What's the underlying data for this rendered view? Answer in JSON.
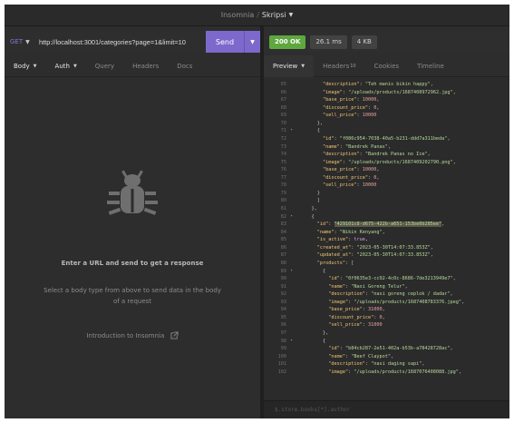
{
  "titlebar": {
    "app": "Insomnia",
    "separator": "/",
    "workspace": "Skripsi"
  },
  "request": {
    "method": "GET",
    "url": "http://localhost:3001/categories?page=1&limit=10",
    "send_label": "Send"
  },
  "response": {
    "status": "200 OK",
    "time": "26.1 ms",
    "size": "4 KB"
  },
  "request_tabs": [
    {
      "label": "Body",
      "dropdown": true,
      "active": true
    },
    {
      "label": "Auth",
      "dropdown": true,
      "active": false
    },
    {
      "label": "Query"
    },
    {
      "label": "Headers"
    },
    {
      "label": "Docs"
    }
  ],
  "response_tabs": [
    {
      "label": "Preview",
      "dropdown": true,
      "active": true
    },
    {
      "label": "Headers",
      "badge": "10"
    },
    {
      "label": "Cookies"
    },
    {
      "label": "Timeline"
    }
  ],
  "empty_state": {
    "icon": "bug-icon",
    "title": "Enter a URL and send to get a response",
    "text": "Select a body type from above to send data in the body of a request",
    "link": "Introduction to Insomnia"
  },
  "filter_placeholder": "$.store.books[*].author",
  "code_lines": [
    {
      "n": "65",
      "t": "\"description\": \"Teh manis bikin happy\","
    },
    {
      "n": "66",
      "t": "\"image\": \"/uploads/products/1687408972962.jpg\","
    },
    {
      "n": "67",
      "t": "\"base_price\": 10000,"
    },
    {
      "n": "68",
      "t": "\"discount_price\": 0,"
    },
    {
      "n": "69",
      "t": "\"sell_price\": 10000"
    },
    {
      "n": "70",
      "t": "},"
    },
    {
      "n": "71",
      "t": "{"
    },
    {
      "n": "72",
      "t": "\"id\": \"f086c954-7038-40a5-b231-ddd7a311beda\","
    },
    {
      "n": "73",
      "t": "\"name\": \"Bandrek Panas\","
    },
    {
      "n": "74",
      "t": "\"description\": \"Bandrek Panas no Ice\","
    },
    {
      "n": "75",
      "t": "\"image\": \"/uploads/products/1687409202790.png\","
    },
    {
      "n": "76",
      "t": "\"base_price\": 10000,"
    },
    {
      "n": "77",
      "t": "\"discount_price\": 0,"
    },
    {
      "n": "78",
      "t": "\"sell_price\": 10000"
    },
    {
      "n": "79",
      "t": "}"
    },
    {
      "n": "80",
      "t": "]"
    },
    {
      "n": "81",
      "t": "},"
    },
    {
      "n": "82",
      "t": "{"
    },
    {
      "n": "83",
      "t": "\"id\": \"429101c8-d675-422b-a651-153be0b285ee\","
    },
    {
      "n": "84",
      "t": "\"name\": \"Nikin Kenyang\","
    },
    {
      "n": "85",
      "t": "\"is_active\": true,"
    },
    {
      "n": "86",
      "t": "\"created_at\": \"2023-05-30T14:07:33.853Z\","
    },
    {
      "n": "87",
      "t": "\"updated_at\": \"2023-05-30T14:07:33.853Z\","
    },
    {
      "n": "88",
      "t": "\"products\": ["
    },
    {
      "n": "89",
      "t": "{"
    },
    {
      "n": "90",
      "t": "\"id\": \"0f0635e3-cc92-4c0c-8686-7de3213949e7\","
    },
    {
      "n": "91",
      "t": "\"name\": \"Nasi Goreng Telur\","
    },
    {
      "n": "92",
      "t": "\"description\": \"nasi goreng ceplok / dadar\","
    },
    {
      "n": "93",
      "t": "\"image\": \"/uploads/products/1687408783376.jpeg\","
    },
    {
      "n": "94",
      "t": "\"base_price\": 31000,"
    },
    {
      "n": "95",
      "t": "\"discount_price\": 0,"
    },
    {
      "n": "96",
      "t": "\"sell_price\": 31000"
    },
    {
      "n": "97",
      "t": "},"
    },
    {
      "n": "98",
      "t": "{"
    },
    {
      "n": "99",
      "t": "\"id\": \"b84cb287-2e51-402a-b53b-a78428728ac\","
    },
    {
      "n": "100",
      "t": "\"name\": \"Beef Claypot\","
    },
    {
      "n": "101",
      "t": "\"description\": \"nasi daging sapi\","
    },
    {
      "n": "102",
      "t": "\"image\": \"/uploads/products/1687076408088.jpg\","
    }
  ],
  "colors": {
    "accent": "#7d69cb",
    "status_ok": "#5fa73f",
    "json_key": "#f0c674",
    "json_string": "#b5d99c",
    "json_number": "#e6a0a0"
  }
}
